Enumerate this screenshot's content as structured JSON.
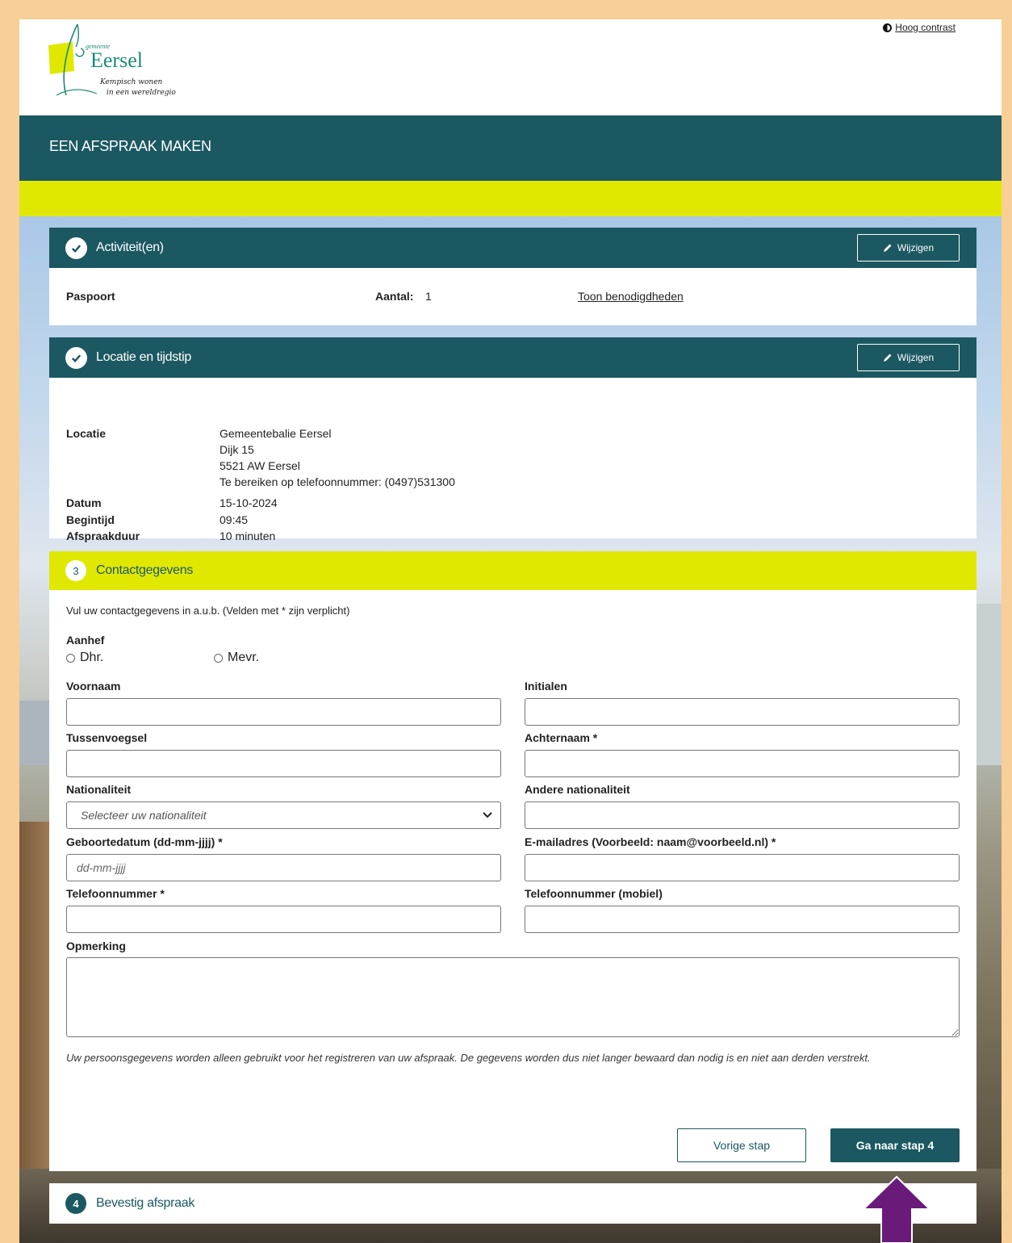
{
  "header": {
    "logo_top": "gemeente",
    "logo_name": "Eersel",
    "logo_tagline_1": "Kempisch wonen",
    "logo_tagline_2": "in een wereldregio",
    "high_contrast": "Hoog contrast"
  },
  "title": "EEN AFSPRAAK MAKEN",
  "colors": {
    "primary": "#1b5862",
    "accent": "#e1e800",
    "outer": "#f8cf97",
    "annotation_arrow": "#6a1b7a"
  },
  "step1": {
    "title": "Activiteit(en)",
    "edit": "Wijzigen",
    "product": "Paspoort",
    "amount_label": "Aantal:",
    "amount": "1",
    "requirements_link": "Toon benodigdheden"
  },
  "step2": {
    "title": "Locatie en tijdstip",
    "edit": "Wijzigen",
    "location_label": "Locatie",
    "location_lines": [
      "Gemeentebalie Eersel",
      "Dijk 15",
      "5521 AW Eersel",
      "Te bereiken op telefoonnummer: (0497)531300"
    ],
    "date_label": "Datum",
    "date": "15-10-2024",
    "start_label": "Begintijd",
    "start": "09:45",
    "duration_label": "Afspraakduur",
    "duration": "10 minuten"
  },
  "step3": {
    "number": "3",
    "title": "Contactgegevens",
    "intro": "Vul uw contactgegevens in a.u.b. (Velden met * zijn verplicht)",
    "salutation_label": "Aanhef",
    "salutation_options": [
      "Dhr.",
      "Mevr."
    ],
    "fields": {
      "first_name": "Voornaam",
      "initials": "Initialen",
      "infix": "Tussenvoegsel",
      "last_name": "Achternaam *",
      "nationality": "Nationaliteit",
      "nationality_placeholder": "Selecteer uw nationaliteit",
      "other_nationality": "Andere nationaliteit",
      "birthdate": "Geboortedatum (dd-mm-jjjj) *",
      "birthdate_placeholder": "dd-mm-jjjj",
      "email": "E-mailadres (Voorbeeld: naam@voorbeeld.nl) *",
      "phone": "Telefoonnummer *",
      "mobile": "Telefoonnummer (mobiel)",
      "remark": "Opmerking"
    },
    "privacy": "Uw persoonsgegevens worden alleen gebruikt voor het registreren van uw afspraak. De gegevens worden dus niet langer bewaard dan nodig is en niet aan derden verstrekt.",
    "prev_button": "Vorige stap",
    "next_button": "Ga naar stap 4"
  },
  "step4": {
    "number": "4",
    "title": "Bevestig afspraak"
  }
}
